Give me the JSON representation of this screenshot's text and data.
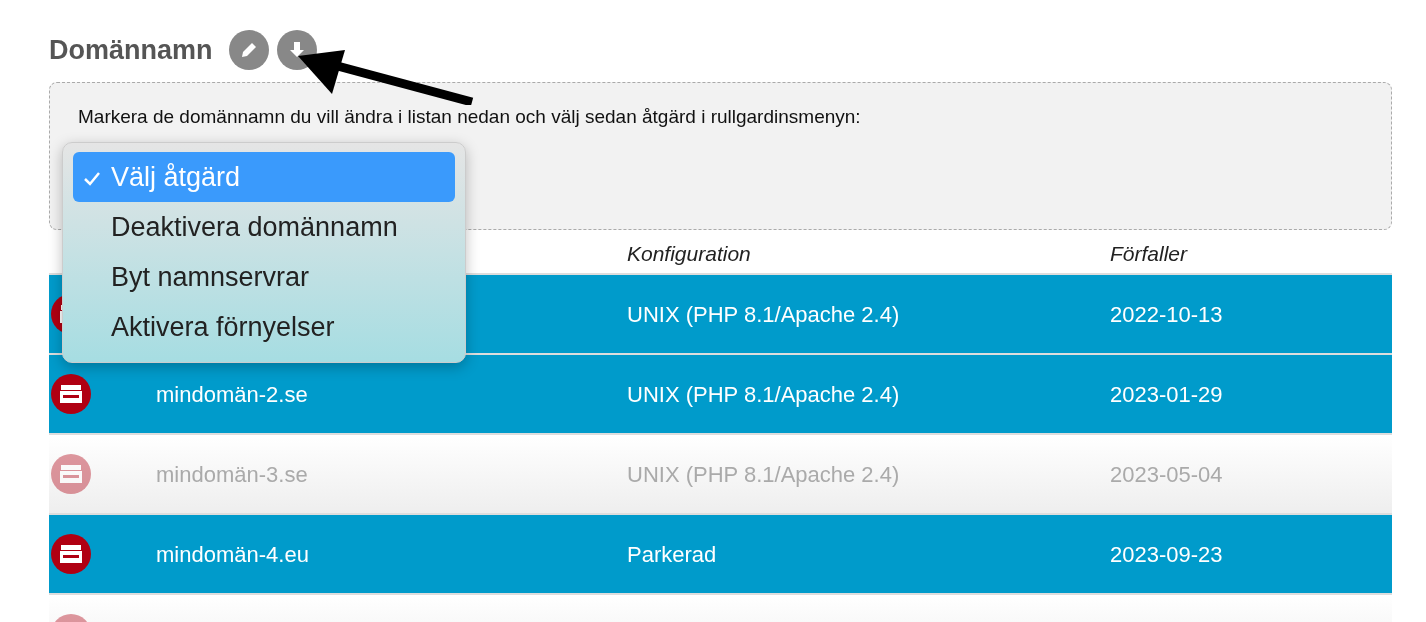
{
  "heading": "Domännamn",
  "instruction": "Markera de domännamn du vill ändra i listan nedan och välj sedan åtgärd i rullgardinsmenyn:",
  "action_menu": [
    {
      "label": "Välj åtgärd",
      "selected": true
    },
    {
      "label": "Deaktivera domännamn",
      "selected": false
    },
    {
      "label": "Byt namnservrar",
      "selected": false
    },
    {
      "label": "Aktivera förnyelser",
      "selected": false
    }
  ],
  "table": {
    "columns": [
      "Konfiguration",
      "Förfaller"
    ],
    "rows": [
      {
        "selected": true,
        "configuration": "UNIX (PHP 8.1/Apache 2.4)",
        "expires": "2022-10-13"
      },
      {
        "selected": true,
        "domain": "mindomän-2.se",
        "configuration": "UNIX (PHP 8.1/Apache 2.4)",
        "expires": "2023-01-29"
      },
      {
        "selected": false,
        "domain": "mindomän-3.se",
        "configuration": "UNIX (PHP 8.1/Apache 2.4)",
        "expires": "2023-05-04"
      },
      {
        "selected": true,
        "domain": "mindomän-4.eu",
        "configuration": "Parkerad",
        "expires": "2023-09-23"
      },
      {
        "selected": false
      }
    ]
  }
}
